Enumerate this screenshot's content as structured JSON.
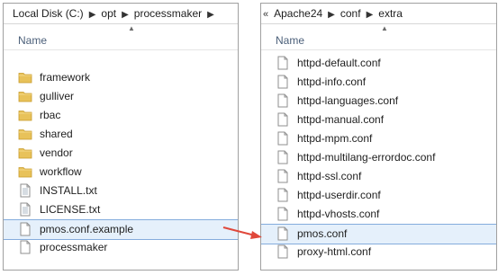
{
  "left": {
    "breadcrumb": [
      "Local Disk (C:)",
      "opt",
      "processmaker"
    ],
    "column_header": "Name",
    "items": [
      {
        "label": "framework",
        "type": "folder"
      },
      {
        "label": "gulliver",
        "type": "folder"
      },
      {
        "label": "rbac",
        "type": "folder"
      },
      {
        "label": "shared",
        "type": "folder"
      },
      {
        "label": "vendor",
        "type": "folder"
      },
      {
        "label": "workflow",
        "type": "folder"
      },
      {
        "label": "INSTALL.txt",
        "type": "text-file"
      },
      {
        "label": "LICENSE.txt",
        "type": "text-file"
      },
      {
        "label": "pmos.conf.example",
        "type": "file",
        "selected": true
      },
      {
        "label": "processmaker",
        "type": "file"
      }
    ]
  },
  "right": {
    "overflow_glyph": "«",
    "breadcrumb": [
      "Apache24",
      "conf",
      "extra"
    ],
    "column_header": "Name",
    "items": [
      {
        "label": "httpd-default.conf",
        "type": "file"
      },
      {
        "label": "httpd-info.conf",
        "type": "file"
      },
      {
        "label": "httpd-languages.conf",
        "type": "file"
      },
      {
        "label": "httpd-manual.conf",
        "type": "file"
      },
      {
        "label": "httpd-mpm.conf",
        "type": "file"
      },
      {
        "label": "httpd-multilang-errordoc.conf",
        "type": "file"
      },
      {
        "label": "httpd-ssl.conf",
        "type": "file"
      },
      {
        "label": "httpd-userdir.conf",
        "type": "file"
      },
      {
        "label": "httpd-vhosts.conf",
        "type": "file"
      },
      {
        "label": "pmos.conf",
        "type": "file",
        "selected": true
      },
      {
        "label": "proxy-html.conf",
        "type": "file"
      }
    ]
  },
  "colors": {
    "selection_bg": "#e5f0fb",
    "selection_border": "#84acdd",
    "header_text": "#4c607a",
    "folder": "#e8c25a",
    "arrow": "#e0483b"
  }
}
